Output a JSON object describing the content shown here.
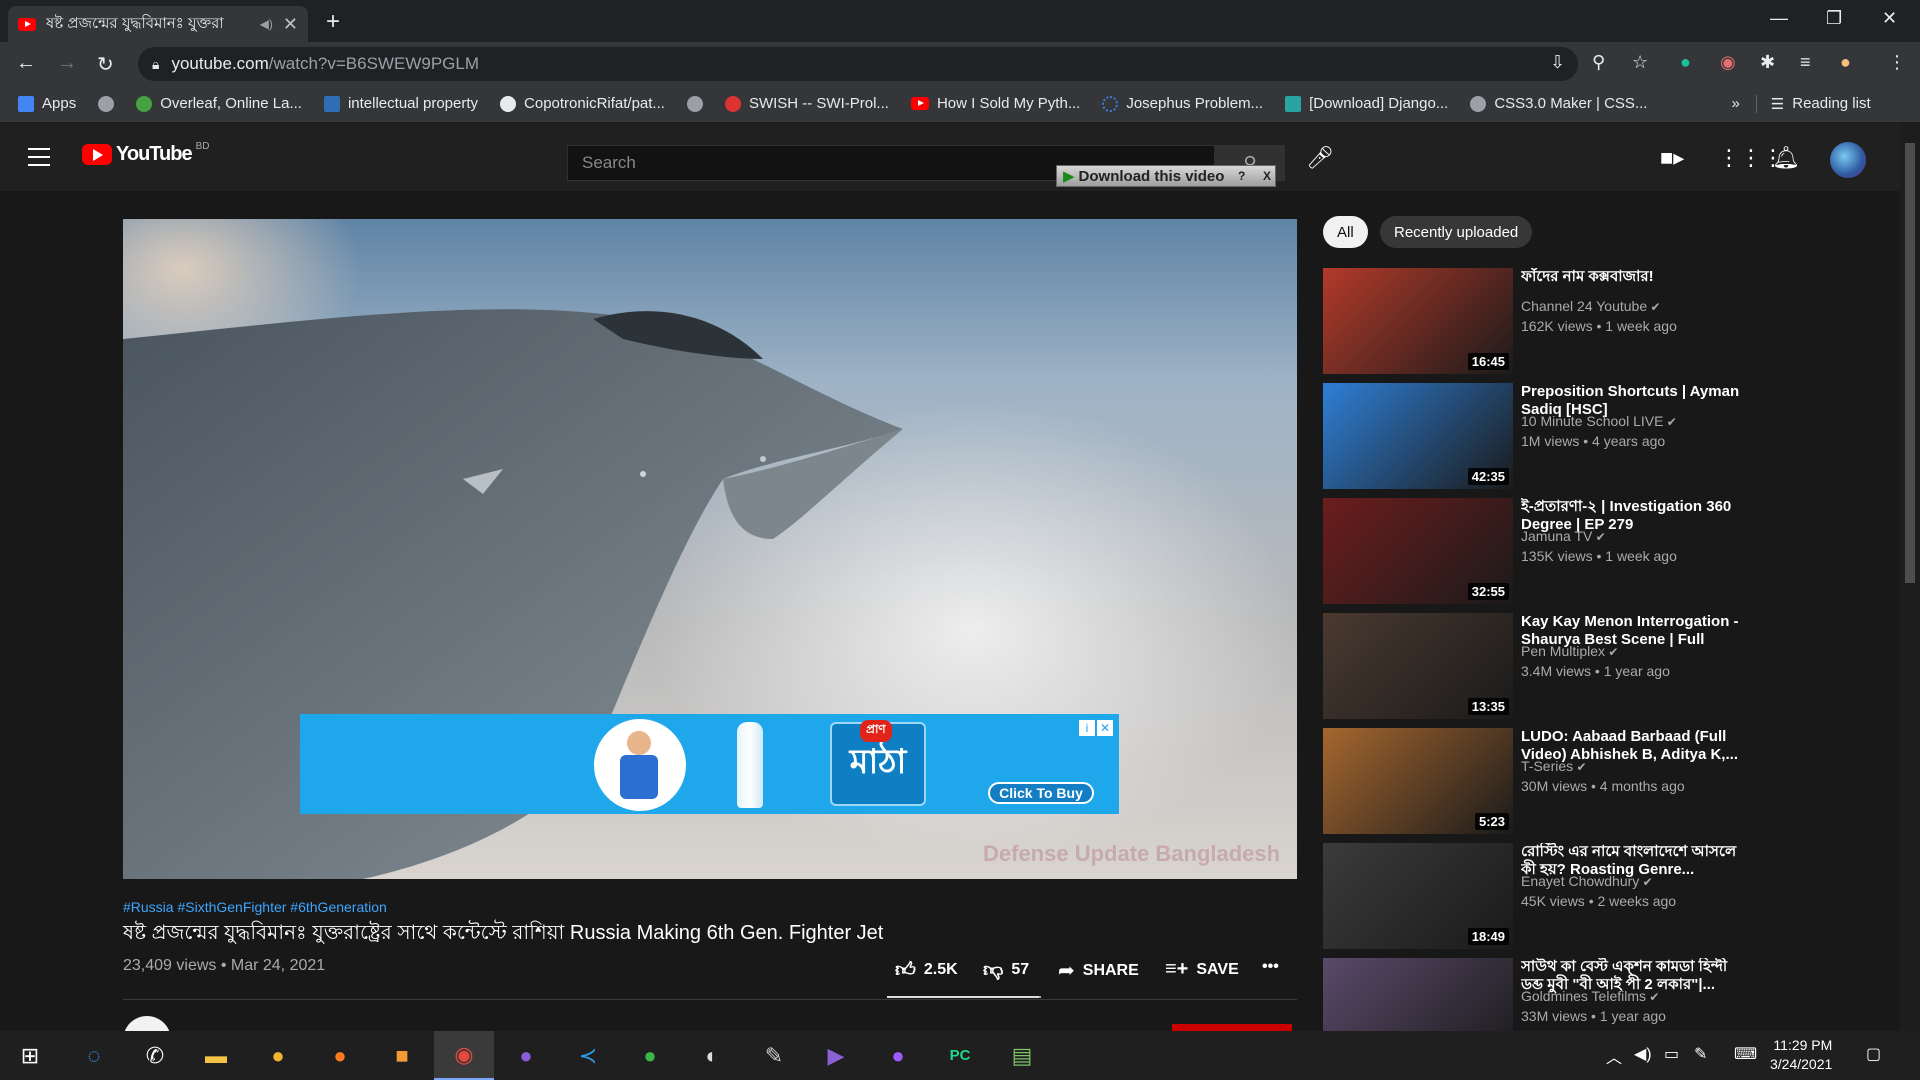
{
  "browser": {
    "tab_title": "ষষ্ট প্রজন্মের যুদ্ধবিমানঃ যুক্তরা",
    "tab_close": "✕",
    "new_tab": "+",
    "url_host": "youtube.com",
    "url_path": "/watch?v=B6SWEW9PGLM",
    "bookmarks": [
      {
        "label": "Apps",
        "color": "#4285f4"
      },
      {
        "label": "",
        "color": "#9aa0a6"
      },
      {
        "label": "Overleaf, Online La...",
        "color": "#47a141"
      },
      {
        "label": "intellectual property",
        "color": "#2f6db5"
      },
      {
        "label": "CopotronicRifat/pat...",
        "color": "#e8eaed"
      },
      {
        "label": "",
        "color": "#9aa0a6"
      },
      {
        "label": "SWISH -- SWI-Prol...",
        "color": "#d33"
      },
      {
        "label": "How I Sold My Pyth...",
        "color": "#ff0000"
      },
      {
        "label": "Josephus Problem...",
        "color": "#3c7dd9"
      },
      {
        "label": "[Download] Django...",
        "color": "#2aa3a3"
      },
      {
        "label": "CSS3.0 Maker | CSS...",
        "color": "#9aa0a6"
      }
    ],
    "bookmarks_more": "»",
    "reading_list": "Reading list"
  },
  "youtube": {
    "logo_text": "YouTube",
    "country_code": "BD",
    "search_placeholder": "Search",
    "download_button": "Download this video",
    "download_help": "?",
    "download_close": "X",
    "accent": "#ff0000"
  },
  "player": {
    "watermark": "Defense Update Bangladesh",
    "ad": {
      "brand_tag": "প্রাণ",
      "brand_name": "মাঠা",
      "cta": "Click To Buy",
      "info": "i",
      "close": "✕"
    }
  },
  "video": {
    "hashtags": "#Russia #SixthGenFighter #6thGeneration",
    "title": "ষষ্ট প্রজন্মের যুদ্ধবিমানঃ যুক্তরাষ্ট্রের সাথে কন্টেস্টে রাশিয়া Russia Making 6th Gen. Fighter Jet",
    "views_date": "23,409 views • Mar 24, 2021",
    "likes": "2.5K",
    "dislikes": "57",
    "share": "SHARE",
    "save": "SAVE",
    "more": "•••"
  },
  "sidebar": {
    "chips": [
      "All",
      "Recently uploaded"
    ],
    "videos": [
      {
        "title": "ফাঁদের নাম কক্সবাজার!",
        "channel": "Channel 24 Youtube",
        "meta": "162K views • 1 week ago",
        "duration": "16:45",
        "thumb_color": "#b33a2a"
      },
      {
        "title": "Preposition Shortcuts | Ayman Sadiq [HSC]",
        "channel": "10 Minute School LIVE",
        "meta": "1M views • 4 years ago",
        "duration": "42:35",
        "thumb_color": "#2f7fd6"
      },
      {
        "title": "ই-প্রতারণা-২ | Investigation 360 Degree | EP 279",
        "channel": "Jamuna TV",
        "meta": "135K views • 1 week ago",
        "duration": "32:55",
        "thumb_color": "#6d1d1d"
      },
      {
        "title": "Kay Kay Menon Interrogation - Shaurya Best Scene | Full Hind...",
        "channel": "Pen Multiplex",
        "meta": "3.4M views • 1 year ago",
        "duration": "13:35",
        "thumb_color": "#4a3a30"
      },
      {
        "title": "LUDO: Aabaad Barbaad (Full Video) Abhishek B, Aditya K,...",
        "channel": "T-Series",
        "meta": "30M views • 4 months ago",
        "duration": "5:23",
        "thumb_color": "#a5672f"
      },
      {
        "title": "রোস্টিং এর নামে বাংলাদেশে আসলে কী হয়? Roasting Genre...",
        "channel": "Enayet Chowdhury",
        "meta": "45K views • 2 weeks ago",
        "duration": "18:49",
        "thumb_color": "#3b3b3b"
      },
      {
        "title": "সাউথ কা বেস্ট এক্শন কামডা হিন্দী ডব্ড মুবী \"বী আই পী 2 লকার\"|...",
        "channel": "Goldmines Telefilms",
        "meta": "33M views • 1 year ago",
        "duration": "",
        "thumb_color": "#5a4a6a"
      }
    ]
  },
  "taskbar": {
    "time": "11:29 PM",
    "date": "3/24/2021"
  }
}
